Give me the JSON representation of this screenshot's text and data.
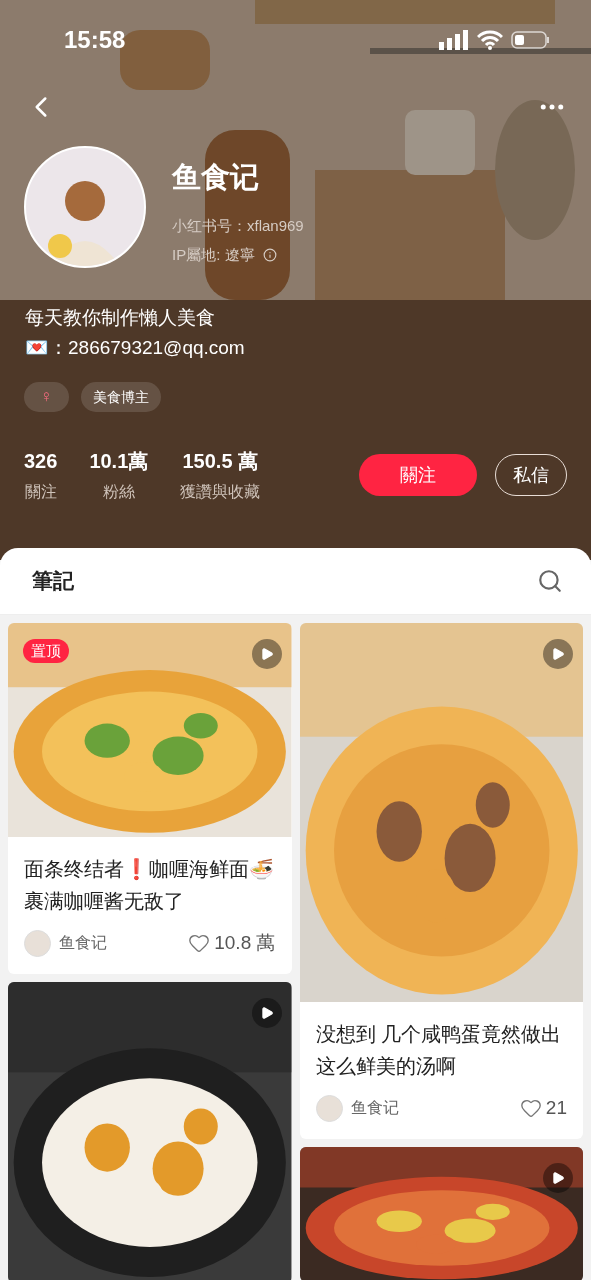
{
  "status_bar": {
    "time": "15:58"
  },
  "profile": {
    "name": "鱼食记",
    "id_line": "小红书号：xflan969",
    "ip_line": "IP屬地: 遼寧",
    "bio": "每天教你制作懶人美食",
    "contact": "💌：286679321@qq.com",
    "tags": [
      {
        "kind": "gender",
        "text": "♀"
      },
      {
        "kind": "label",
        "text": "美食博主"
      }
    ],
    "stats": [
      {
        "value": "326",
        "label": "關注"
      },
      {
        "value": "10.1萬",
        "label": "粉絲"
      },
      {
        "value": "150.5 萬",
        "label": "獲讚與收藏"
      }
    ],
    "follow_button": "關注",
    "message_button": "私信"
  },
  "notes_tab": {
    "title": "筆記"
  },
  "columns": [
    [
      {
        "video": true,
        "badge": "置顶",
        "title": "面条终结者❗咖喱海鲜面🍜裹满咖喱酱无敌了",
        "author": "鱼食记",
        "likes": "10.8 萬"
      },
      {
        "video": true
      }
    ],
    [
      {
        "video": true,
        "title": "没想到 几个咸鸭蛋竟然做出这么鲜美的汤啊",
        "author": "鱼食记",
        "likes": "21"
      },
      {
        "video": true
      }
    ]
  ]
}
